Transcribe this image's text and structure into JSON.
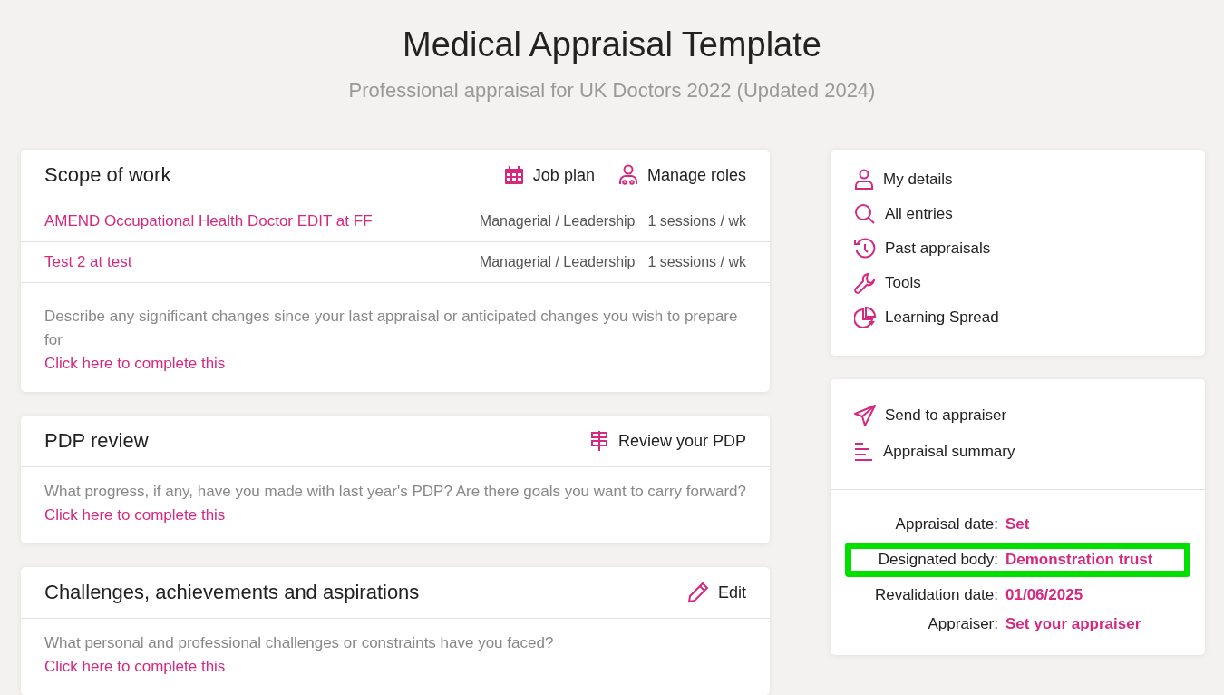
{
  "header": {
    "title": "Medical Appraisal Template",
    "subtitle": "Professional appraisal for UK Doctors 2022 (Updated 2024)"
  },
  "sections": [
    {
      "title": "Scope of work",
      "actions": [
        {
          "kind": "calendar",
          "label": "Job plan"
        },
        {
          "kind": "roles",
          "label": "Manage roles"
        }
      ],
      "roles": [
        {
          "name": "AMEND Occupational Health Doctor EDIT at FF",
          "category": "Managerial / Leadership",
          "sessions": "1 sessions / wk"
        },
        {
          "name": "Test 2 at test",
          "category": "Managerial / Leadership",
          "sessions": "1 sessions / wk"
        }
      ],
      "prompt": "Describe any significant changes since your last appraisal or anticipated changes you wish to prepare for",
      "link": "Click here to complete this"
    },
    {
      "title": "PDP review",
      "actions": [
        {
          "kind": "signpost",
          "label": "Review your PDP"
        }
      ],
      "prompt": "What progress, if any, have you made with last year's PDP? Are there goals you want to carry forward?",
      "link": "Click here to complete this"
    },
    {
      "title": "Challenges, achievements and aspirations",
      "actions": [
        {
          "kind": "pencil",
          "label": "Edit"
        }
      ],
      "prompt": "What personal and professional challenges or constraints have you faced?",
      "link": "Click here to complete this"
    }
  ],
  "menu": [
    {
      "kind": "person",
      "label": "My details"
    },
    {
      "kind": "search",
      "label": "All entries"
    },
    {
      "kind": "history",
      "label": "Past appraisals"
    },
    {
      "kind": "wrench",
      "label": "Tools"
    },
    {
      "kind": "pie",
      "label": "Learning Spread"
    }
  ],
  "submission": {
    "actions": [
      {
        "kind": "send",
        "label": "Send to appraiser"
      },
      {
        "kind": "lines",
        "label": "Appraisal summary"
      }
    ],
    "details": [
      {
        "label": "Appraisal date:",
        "value": "Set",
        "highlighted": false
      },
      {
        "label": "Designated body:",
        "value": "Demonstration trust",
        "highlighted": true
      },
      {
        "label": "Revalidation date:",
        "value": "01/06/2025",
        "highlighted": false
      },
      {
        "label": "Appraiser:",
        "value": "Set your appraiser",
        "highlighted": false
      }
    ]
  }
}
